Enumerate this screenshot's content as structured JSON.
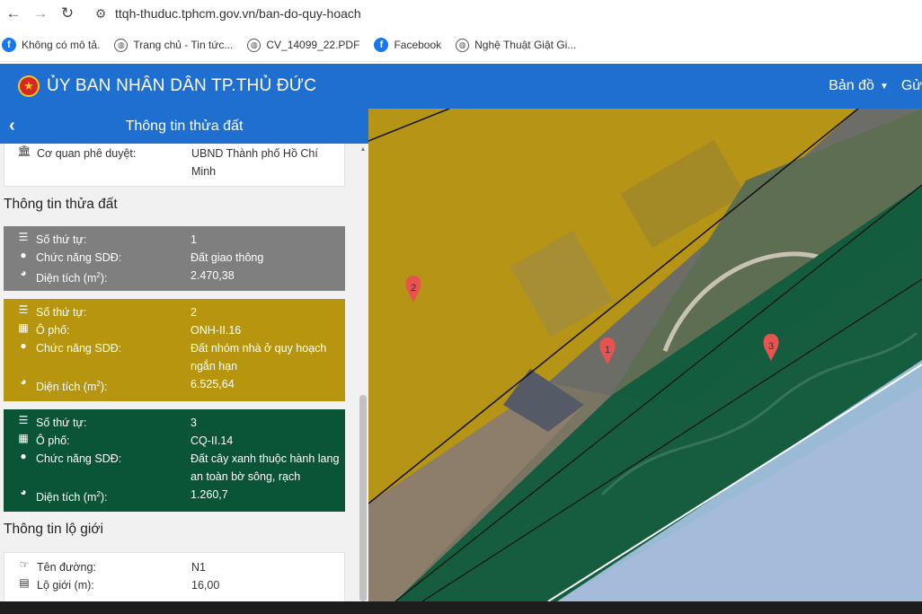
{
  "browser": {
    "url": "ttqh-thuduc.tphcm.gov.vn/ban-do-quy-hoach",
    "bookmarks": [
      {
        "label": "Không có mô tả.",
        "icon": "facebook-icon"
      },
      {
        "label": "Trang chủ - Tin tức...",
        "icon": "globe-icon"
      },
      {
        "label": "CV_14099_22.PDF",
        "icon": "globe-icon"
      },
      {
        "label": "Facebook",
        "icon": "facebook-icon"
      },
      {
        "label": "Nghệ Thuật Giật Gi...",
        "icon": "globe-icon"
      }
    ]
  },
  "header": {
    "title": "ỦY BAN NHÂN DÂN TP.THỦ ĐỨC",
    "menu_map": "Bản đồ",
    "menu_send": "Gử",
    "color": "#1f6fd1"
  },
  "sidebar": {
    "title": "Thông tin thửa đất",
    "approval": {
      "label": "Cơ quan phê duyệt:",
      "value": "UBND Thành phố Hồ Chí Minh"
    },
    "parcel_section_title": "Thông tin thửa đất",
    "parcels": [
      {
        "color": "#7f7f7f",
        "stt_label": "Số thứ tự:",
        "stt": "1",
        "function_label": "Chức năng SDĐ:",
        "function": "Đất giao thông",
        "area_label": "Diện tích (m",
        "area_sup": "2",
        "area_suffix": "):",
        "area": "2.470,38"
      },
      {
        "color": "#b8950e",
        "stt_label": "Số thứ tự:",
        "stt": "2",
        "block_label": "Ô phố:",
        "block": "ONH-II.16",
        "function_label": "Chức năng SDĐ:",
        "function": "Đất nhóm nhà ở quy hoạch ngắn hạn",
        "area_label": "Diện tích (m",
        "area_sup": "2",
        "area_suffix": "):",
        "area": "6.525,64"
      },
      {
        "color": "#0a5538",
        "stt_label": "Số thứ tự:",
        "stt": "3",
        "block_label": "Ô phố:",
        "block": "CQ-II.14",
        "function_label": "Chức năng SDĐ:",
        "function": "Đất cây xanh thuộc hành lang an toàn bờ sông, rạch",
        "area_label": "Diện tích (m",
        "area_sup": "2",
        "area_suffix": "):",
        "area": "1.260,7"
      }
    ],
    "road_section_title": "Thông tin lộ giới",
    "road": {
      "name_label": "Tên đường:",
      "name": "N1",
      "width_label": "Lộ giới (m):",
      "width": "16,00"
    }
  },
  "map": {
    "markers": [
      "2",
      "1",
      "3"
    ]
  }
}
